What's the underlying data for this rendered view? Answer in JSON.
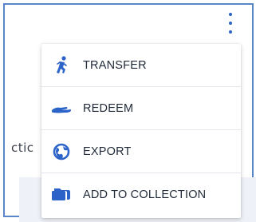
{
  "background": {
    "partial_text": "ctic"
  },
  "more_menu": {
    "trigger_icon": "kebab-vertical-icon",
    "items": [
      {
        "label": "TRANSFER",
        "icon": "runner-icon"
      },
      {
        "label": "REDEEM",
        "icon": "hand-icon"
      },
      {
        "label": "EXPORT",
        "icon": "globe-icon"
      },
      {
        "label": "ADD TO COLLECTION",
        "icon": "folder-icon"
      }
    ]
  },
  "colors": {
    "accent": "#2c63c9",
    "frame_border": "#5b85c9",
    "text": "#1f2937"
  }
}
